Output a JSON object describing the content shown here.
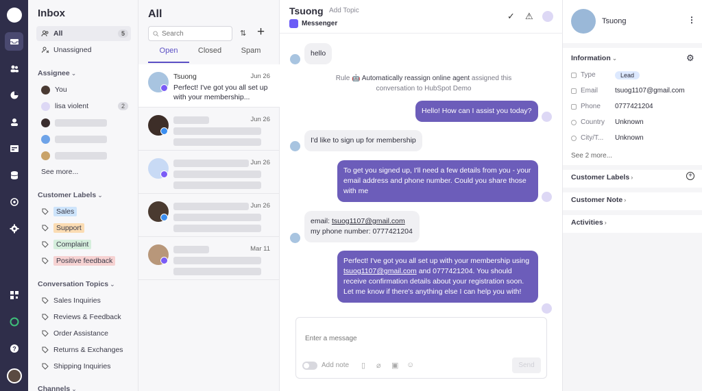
{
  "sidebar": {
    "title": "Inbox",
    "views": [
      {
        "label": "All",
        "count": "5"
      },
      {
        "label": "Unassigned"
      }
    ],
    "assignee_heading": "Assignee",
    "assignees": [
      {
        "label": "You"
      },
      {
        "label": "lisa violent",
        "count": "2"
      }
    ],
    "see_more": "See more...",
    "labels_heading": "Customer Labels",
    "labels": [
      {
        "label": "Sales",
        "color": "#cde4fb"
      },
      {
        "label": "Support",
        "color": "#fbdcb3"
      },
      {
        "label": "Complaint",
        "color": "#d5eedc"
      },
      {
        "label": "Positive feedback",
        "color": "#f6d2d2"
      }
    ],
    "topics_heading": "Conversation Topics",
    "topics": [
      {
        "label": "Sales Inquiries"
      },
      {
        "label": "Reviews & Feedback"
      },
      {
        "label": "Order Assistance"
      },
      {
        "label": "Returns & Exchanges"
      },
      {
        "label": "Shipping Inquiries"
      }
    ],
    "channels_heading": "Channels"
  },
  "list": {
    "title": "All",
    "search_placeholder": "Search",
    "tabs": [
      {
        "label": "Open"
      },
      {
        "label": "Closed"
      },
      {
        "label": "Spam"
      }
    ],
    "conversations": [
      {
        "name": "Tsuong",
        "date": "Jun 26",
        "snippet": "Perfect! I've got you all set up with your membership..."
      },
      {
        "date": "Jun 26"
      },
      {
        "date": "Jun 26"
      },
      {
        "date": "Jun 26"
      },
      {
        "date": "Mar 11"
      }
    ]
  },
  "chat": {
    "contact_name": "Tsuong",
    "add_topic": "Add Topic",
    "channel": "Messenger",
    "system_rule_prefix": "Rule",
    "system_rule_name": "Automatically reassign online agent",
    "system_rule_suffix": "assigned this conversation to HubSpot Demo",
    "messages": [
      {
        "text": "hello"
      },
      {
        "text": "Hello! How can I assist you today?"
      },
      {
        "text": "I'd like to sign up for membership"
      },
      {
        "text": "To get you signed up, I'll need a few details from you - your email address and phone number. Could you share those with me"
      },
      {
        "line1_prefix": "email: ",
        "email": "tsuog1107@gmail.com",
        "line2": "my phone number: 0777421204"
      },
      {
        "prefix": "Perfect! I've got you all set up with your membership using ",
        "email": "tsuog1107@gmail.com",
        "suffix": " and 0777421204. You should receive confirmation details about your registration soon. Let me know if there's anything else I can help you with!"
      }
    ],
    "composer_placeholder": "Enter a message",
    "add_note": "Add note",
    "send_label": "Send"
  },
  "panel": {
    "name": "Tsuong",
    "information_heading": "Information",
    "fields": [
      {
        "label": "Type",
        "value": "Lead"
      },
      {
        "label": "Email",
        "value": "tsuog1107@gmail.com"
      },
      {
        "label": "Phone",
        "value": "0777421204"
      },
      {
        "label": "Country",
        "value": "Unknown"
      },
      {
        "label": "City/T...",
        "value": "Unknown"
      }
    ],
    "see_more": "See 2 more...",
    "customer_labels": "Customer Labels",
    "customer_note": "Customer Note",
    "activities": "Activities"
  },
  "colors": {
    "rail": "#2f2e4a",
    "accent": "#5b4fc4",
    "outgoing_bubble": "#6c5dba"
  }
}
